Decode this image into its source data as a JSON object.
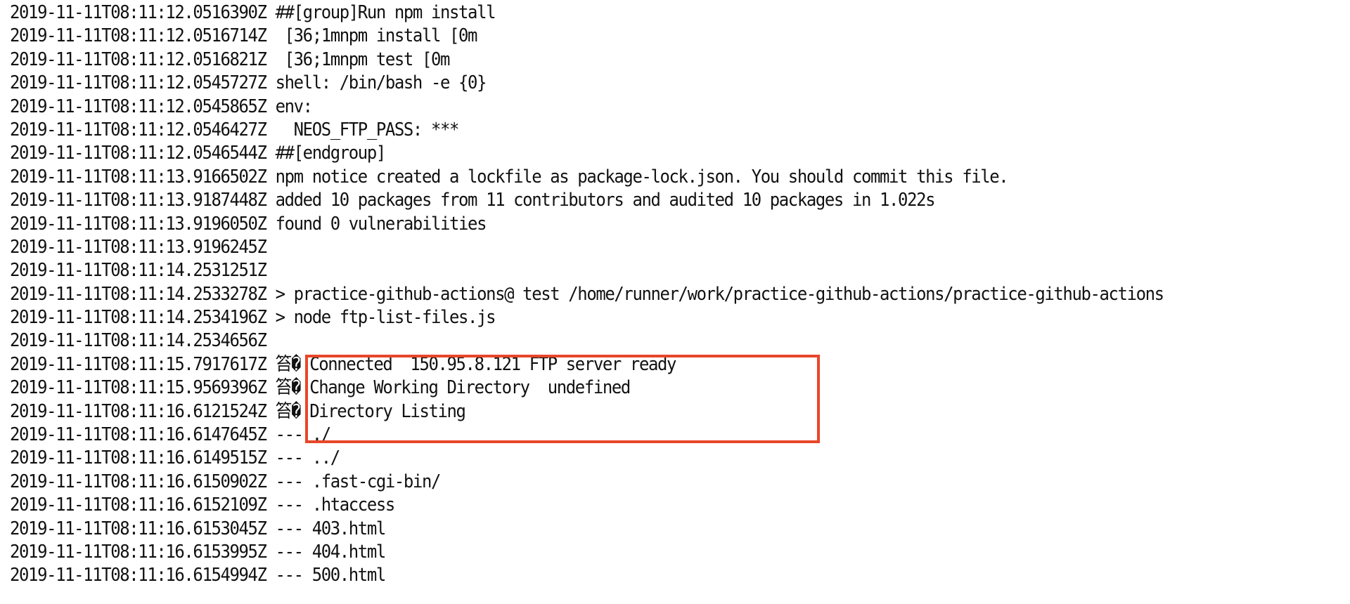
{
  "log": {
    "lines": [
      {
        "ts": "2019-11-11T08:11:12.0516390Z",
        "msg": "##[group]Run npm install"
      },
      {
        "ts": "2019-11-11T08:11:12.0516714Z",
        "msg": " [36;1mnpm install [0m"
      },
      {
        "ts": "2019-11-11T08:11:12.0516821Z",
        "msg": " [36;1mnpm test [0m"
      },
      {
        "ts": "2019-11-11T08:11:12.0545727Z",
        "msg": "shell: /bin/bash -e {0}"
      },
      {
        "ts": "2019-11-11T08:11:12.0545865Z",
        "msg": "env:"
      },
      {
        "ts": "2019-11-11T08:11:12.0546427Z",
        "msg": "  NEOS_FTP_PASS: ***"
      },
      {
        "ts": "2019-11-11T08:11:12.0546544Z",
        "msg": "##[endgroup]"
      },
      {
        "ts": "2019-11-11T08:11:13.9166502Z",
        "msg": "npm notice created a lockfile as package-lock.json. You should commit this file."
      },
      {
        "ts": "2019-11-11T08:11:13.9187448Z",
        "msg": "added 10 packages from 11 contributors and audited 10 packages in 1.022s"
      },
      {
        "ts": "2019-11-11T08:11:13.9196050Z",
        "msg": "found 0 vulnerabilities"
      },
      {
        "ts": "2019-11-11T08:11:13.9196245Z",
        "msg": ""
      },
      {
        "ts": "2019-11-11T08:11:14.2531251Z",
        "msg": ""
      },
      {
        "ts": "2019-11-11T08:11:14.2533278Z",
        "msg": "> practice-github-actions@ test /home/runner/work/practice-github-actions/practice-github-actions"
      },
      {
        "ts": "2019-11-11T08:11:14.2534196Z",
        "msg": "> node ftp-list-files.js"
      },
      {
        "ts": "2019-11-11T08:11:14.2534656Z",
        "msg": ""
      },
      {
        "ts": "2019-11-11T08:11:15.7917617Z",
        "msg": "笞� Connected  150.95.8.121 FTP server ready"
      },
      {
        "ts": "2019-11-11T08:11:15.9569396Z",
        "msg": "笞� Change Working Directory  undefined"
      },
      {
        "ts": "2019-11-11T08:11:16.6121524Z",
        "msg": "笞� Directory Listing"
      },
      {
        "ts": "2019-11-11T08:11:16.6147645Z",
        "msg": "--- ./"
      },
      {
        "ts": "2019-11-11T08:11:16.6149515Z",
        "msg": "--- ../"
      },
      {
        "ts": "2019-11-11T08:11:16.6150902Z",
        "msg": "--- .fast-cgi-bin/"
      },
      {
        "ts": "2019-11-11T08:11:16.6152109Z",
        "msg": "--- .htaccess"
      },
      {
        "ts": "2019-11-11T08:11:16.6153045Z",
        "msg": "--- 403.html"
      },
      {
        "ts": "2019-11-11T08:11:16.6153995Z",
        "msg": "--- 404.html"
      },
      {
        "ts": "2019-11-11T08:11:16.6154994Z",
        "msg": "--- 500.html"
      }
    ]
  },
  "highlight": {
    "color": "#e8462a"
  }
}
